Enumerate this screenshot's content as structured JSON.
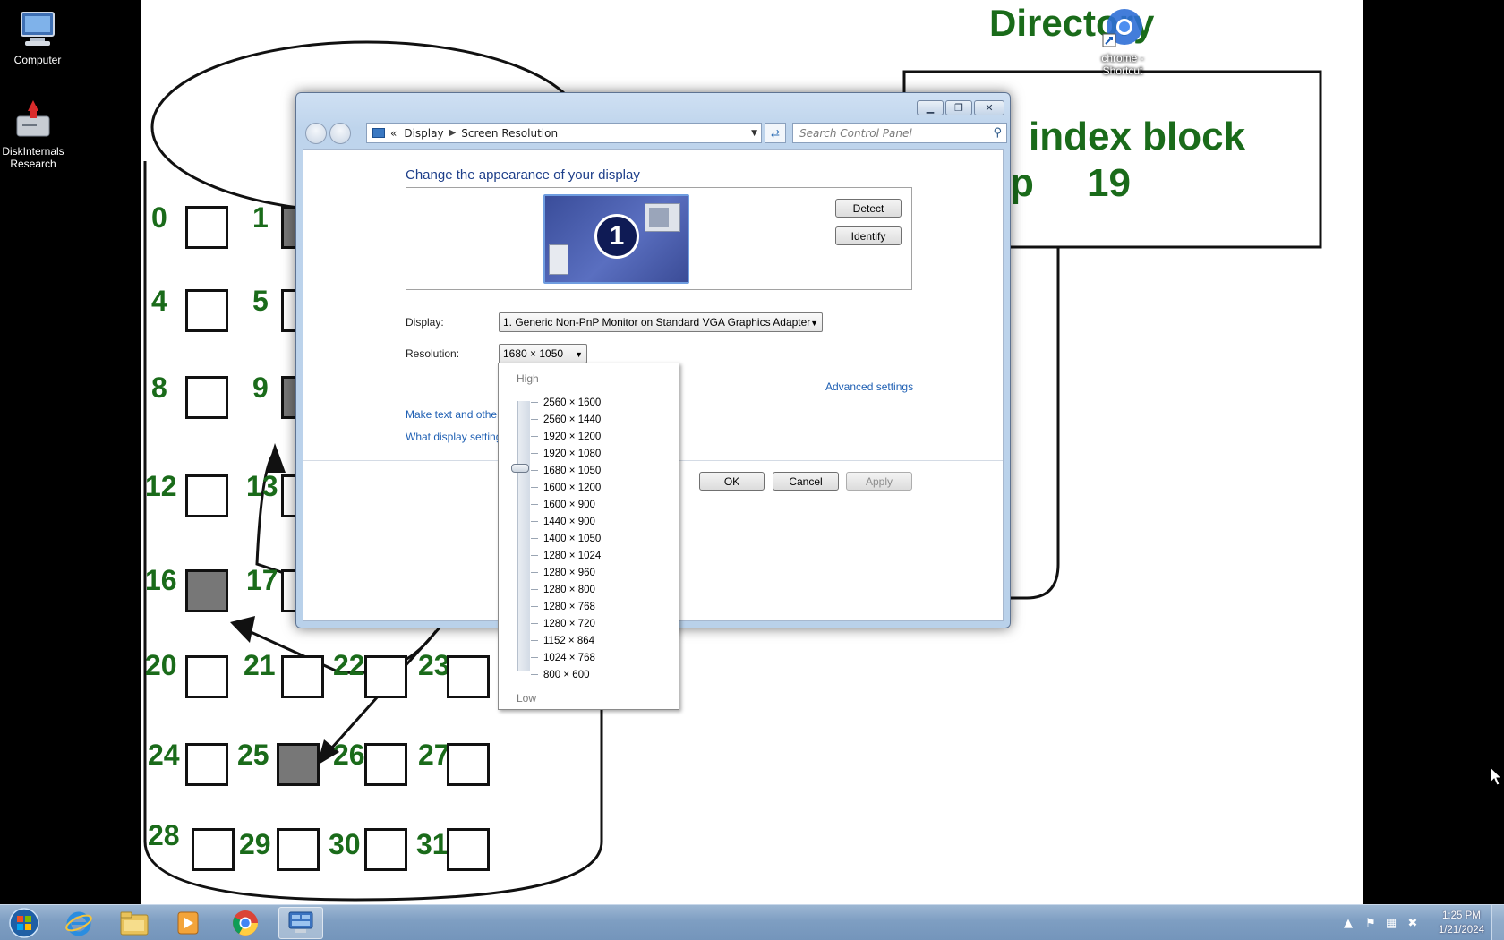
{
  "desktop": {
    "icons": [
      {
        "label": "Computer",
        "icon": "computer-icon"
      },
      {
        "label": "DiskInternals Research",
        "icon": "diskinternals-icon"
      },
      {
        "label": "chrome - Shortcut",
        "icon": "chrome-shortcut-icon"
      }
    ]
  },
  "wallpaper": {
    "title": "Directory",
    "index_block": "index block",
    "p_label": "p",
    "block_num": "19",
    "block_numbers": [
      "0",
      "1",
      "4",
      "5",
      "8",
      "9",
      "12",
      "13",
      "16",
      "17",
      "20",
      "21",
      "22",
      "23",
      "24",
      "25",
      "26",
      "27",
      "28",
      "29",
      "30",
      "31"
    ]
  },
  "window": {
    "breadcrumb": [
      "«",
      "Display",
      "Screen Resolution"
    ],
    "search_placeholder": "Search Control Panel",
    "heading": "Change the appearance of your display",
    "monitor_number": "1",
    "detect_label": "Detect",
    "identify_label": "Identify",
    "display_label": "Display:",
    "display_value": "1. Generic Non-PnP Monitor on Standard VGA Graphics Adapter",
    "resolution_label": "Resolution:",
    "resolution_value": "1680 × 1050",
    "advanced_link": "Advanced settings",
    "link_text_size": "Make text and other",
    "link_display_settings": "What display setting",
    "ok_label": "OK",
    "cancel_label": "Cancel",
    "apply_label": "Apply"
  },
  "resolution_dropdown": {
    "high_label": "High",
    "low_label": "Low",
    "selected": "1680 × 1050",
    "options": [
      "2560 × 1600",
      "2560 × 1440",
      "1920 × 1200",
      "1920 × 1080",
      "1680 × 1050",
      "1600 × 1200",
      "1600 × 900",
      "1440 × 900",
      "1400 × 1050",
      "1280 × 1024",
      "1280 × 960",
      "1280 × 800",
      "1280 × 768",
      "1280 × 720",
      "1152 × 864",
      "1024 × 768",
      "800 × 600"
    ]
  },
  "taskbar": {
    "items": [
      "start-orb-icon",
      "internet-explorer-icon",
      "file-explorer-icon",
      "media-player-icon",
      "chrome-icon",
      "control-panel-icon"
    ],
    "time": "1:25 PM",
    "date": "1/21/2024"
  }
}
